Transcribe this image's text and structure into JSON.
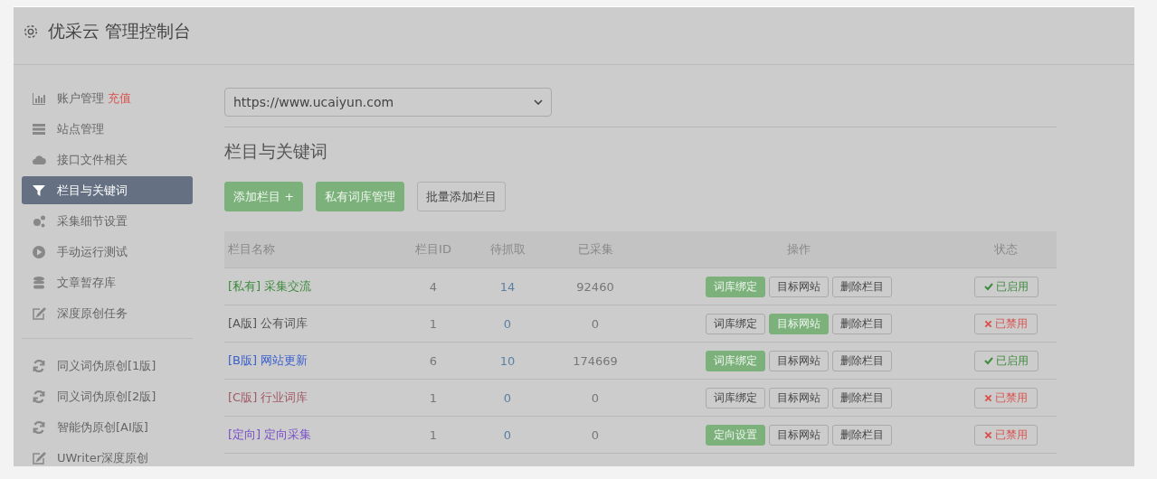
{
  "header": {
    "title": "优采云 管理控制台"
  },
  "sidebar": {
    "items": [
      {
        "label": "账户管理",
        "badge": "充值",
        "selected": false
      },
      {
        "label": "站点管理",
        "selected": false
      },
      {
        "label": "接口文件相关",
        "selected": false
      },
      {
        "label": "栏目与关键词",
        "selected": true
      },
      {
        "label": "采集细节设置",
        "selected": false
      },
      {
        "label": "手动运行测试",
        "selected": false
      },
      {
        "label": "文章暂存库",
        "selected": false
      },
      {
        "label": "深度原创任务",
        "selected": false
      }
    ],
    "tools": [
      {
        "label": "同义词伪原创[1版]"
      },
      {
        "label": "同义词伪原创[2版]"
      },
      {
        "label": "智能伪原创[AI版]"
      },
      {
        "label": "UWriter深度原创"
      }
    ]
  },
  "site_select": {
    "value": "https://www.ucaiyun.com"
  },
  "section_title": "栏目与关键词",
  "toolbar": [
    {
      "label": "添加栏目 +",
      "primary": true
    },
    {
      "label": "私有词库管理",
      "primary": true
    },
    {
      "label": "批量添加栏目",
      "primary": false
    }
  ],
  "table": {
    "columns": [
      "栏目名称",
      "栏目ID",
      "待抓取",
      "已采集",
      "操作",
      "状态"
    ],
    "rows": [
      {
        "name": "[私有] 采集交流",
        "color": "#3d8b3d",
        "id": "4",
        "pending": "14",
        "collected": "92460",
        "actions": [
          {
            "label": "词库绑定",
            "primary": true
          },
          {
            "label": "目标网站",
            "primary": false
          },
          {
            "label": "删除栏目",
            "primary": false
          }
        ],
        "status": "已启用",
        "enabled": true
      },
      {
        "name": "[A版] 公有词库",
        "color": "#555555",
        "id": "1",
        "pending": "0",
        "collected": "0",
        "actions": [
          {
            "label": "词库绑定",
            "primary": false
          },
          {
            "label": "目标网站",
            "primary": true
          },
          {
            "label": "删除栏目",
            "primary": false
          }
        ],
        "status": "已禁用",
        "enabled": false
      },
      {
        "name": "[B版] 网站更新",
        "color": "#3a5fcd",
        "id": "6",
        "pending": "10",
        "collected": "174669",
        "actions": [
          {
            "label": "词库绑定",
            "primary": true
          },
          {
            "label": "目标网站",
            "primary": false
          },
          {
            "label": "删除栏目",
            "primary": false
          }
        ],
        "status": "已启用",
        "enabled": true
      },
      {
        "name": "[C版] 行业词库",
        "color": "#a05a66",
        "id": "1",
        "pending": "0",
        "collected": "0",
        "actions": [
          {
            "label": "词库绑定",
            "primary": false
          },
          {
            "label": "目标网站",
            "primary": false
          },
          {
            "label": "删除栏目",
            "primary": false
          }
        ],
        "status": "已禁用",
        "enabled": false
      },
      {
        "name": "[定向] 定向采集",
        "color": "#7b4fc9",
        "id": "1",
        "pending": "0",
        "collected": "0",
        "actions": [
          {
            "label": "定向设置",
            "primary": true
          },
          {
            "label": "目标网站",
            "primary": false
          },
          {
            "label": "删除栏目",
            "primary": false
          }
        ],
        "status": "已禁用",
        "enabled": false
      }
    ]
  }
}
